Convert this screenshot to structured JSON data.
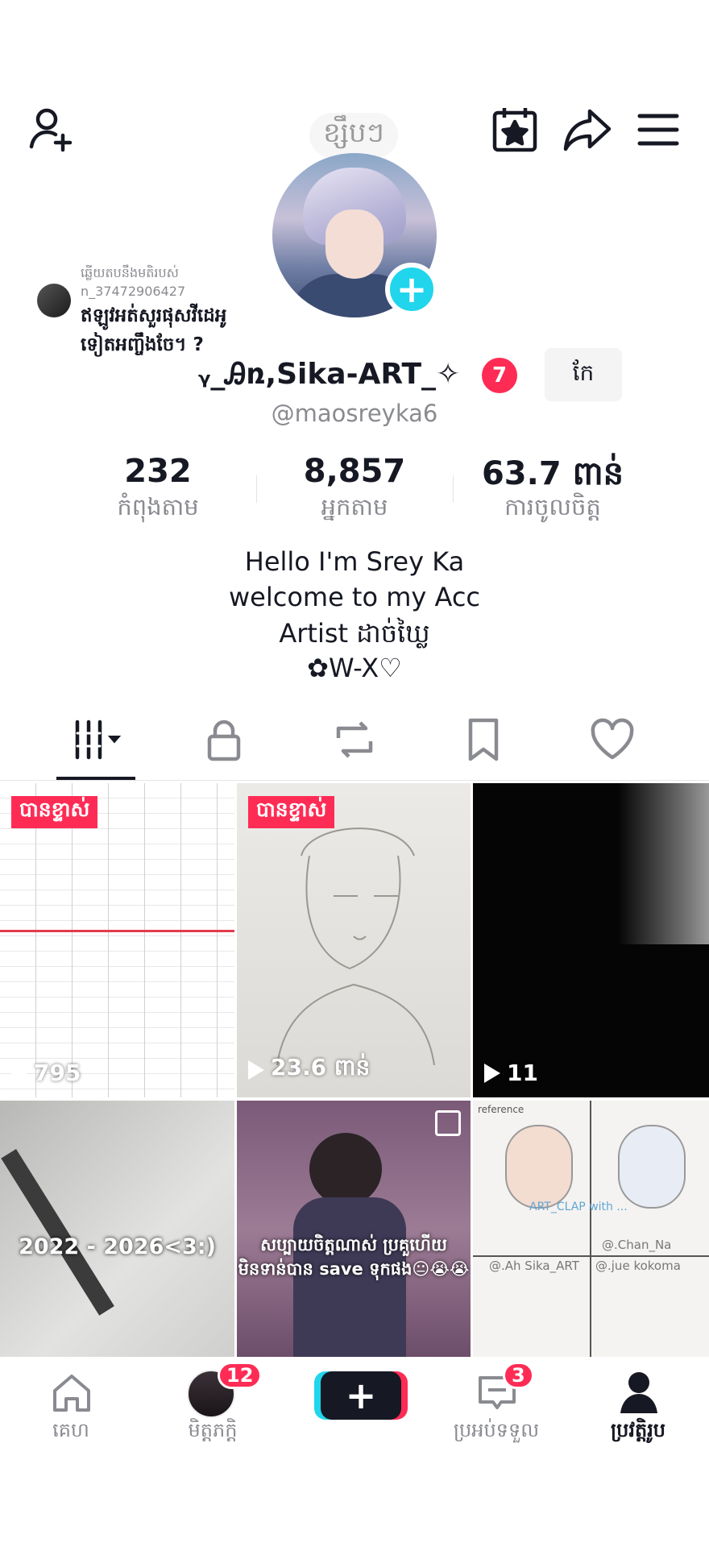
{
  "header": {
    "title": "ខ្សឹបៗ",
    "add_friend_icon": "add-user-icon",
    "calendar_icon": "calendar-star-icon",
    "share_icon": "share-icon",
    "menu_icon": "hamburger-menu-icon"
  },
  "note": {
    "caption_line1": "ឆ្លើយតបនឹងមតិរបស់",
    "caption_line2": "n_37472906427",
    "text_line1": "ឥឡូវអត់សួរផុសវីដេអូ",
    "text_line2": "ទៀតអញ្ចឹងចែ។ ?"
  },
  "profile": {
    "display_name": "ᵧ_Ꭿռ,Sika-ART_✧",
    "name_badge": "7",
    "edit_label": "កែ",
    "handle": "@maosreyka6"
  },
  "stats": [
    {
      "value": "232",
      "label": "កំពុងតាម"
    },
    {
      "value": "8,857",
      "label": "អ្នកតាម"
    },
    {
      "value": "63.7 ពាន់",
      "label": "ការចូលចិត្ត"
    }
  ],
  "bio": [
    "Hello I'm Srey Ka",
    "welcome to my Acc",
    "Artist ដាច់ឃ្លៃ",
    "✿W-X♡"
  ],
  "tabs": [
    "videos-grid-icon",
    "lock-icon",
    "repost-icon",
    "bookmark-icon",
    "heart-icon"
  ],
  "videos": [
    {
      "tag": "បានខ្ទាស់",
      "views": "795"
    },
    {
      "tag": "បានខ្ទាស់",
      "views": "23.6 ពាន់"
    },
    {
      "tag": "",
      "views": "11"
    },
    {
      "caption": "2022 - 2026<3:)"
    },
    {
      "caption_line1": "សប្បាយចិត្តណាស់ ប្រគួហើយ",
      "caption_line2": "មិនទាន់បាន save ទុកផង😐😭😭"
    },
    {
      "text1": "reference",
      "text2": "ART_CLAP with ...",
      "text3": "@.Chan_Na",
      "text4": "@.Ah Sika_ART",
      "text5": "@.jue kokoma"
    }
  ],
  "nav": [
    {
      "label": "គេហ",
      "icon": "home-icon"
    },
    {
      "label": "មិត្តភក្តិ",
      "icon": "friends-avatar",
      "badge": "12"
    },
    {
      "label": "",
      "icon": "create-plus-icon"
    },
    {
      "label": "ប្រអប់ទទួល",
      "icon": "inbox-icon",
      "badge": "3"
    },
    {
      "label": "ប្រវត្តិរូប",
      "icon": "profile-icon"
    }
  ],
  "colors": {
    "accent": "#fe2c55",
    "cyan": "#20d5ec",
    "text": "#161823",
    "muted": "#8a8b91"
  }
}
